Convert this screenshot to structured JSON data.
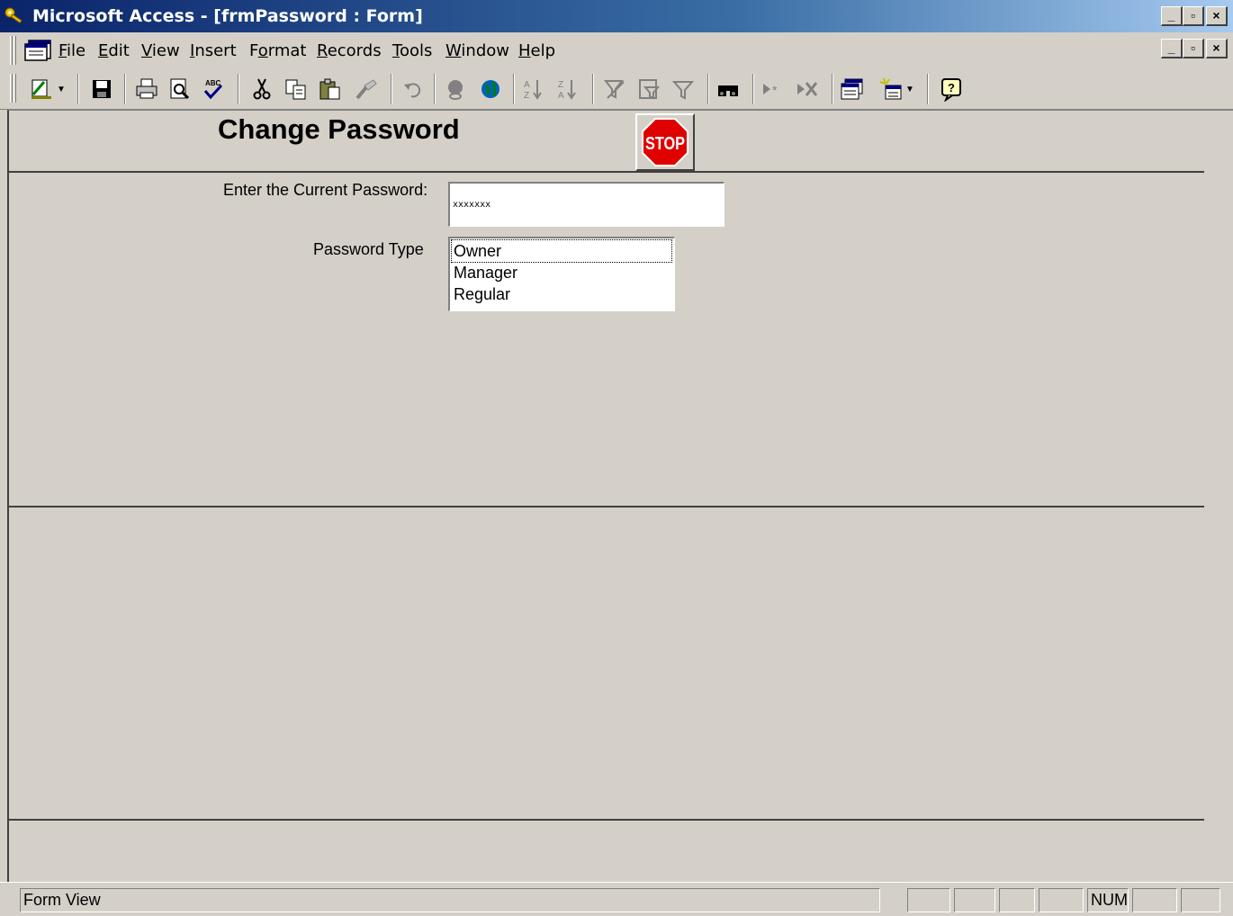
{
  "window": {
    "title": "Microsoft Access - [frmPassword : Form]",
    "controls": [
      "_",
      "□",
      "×"
    ]
  },
  "menubar": {
    "items": [
      {
        "label": "File",
        "key": "F",
        "rest": "ile"
      },
      {
        "label": "Edit",
        "key": "E",
        "rest": "dit"
      },
      {
        "label": "View",
        "key": "V",
        "rest": "iew"
      },
      {
        "label": "Insert",
        "key": "I",
        "rest": "nsert"
      },
      {
        "label": "Format",
        "pre": "F",
        "key": "o",
        "rest": "rmat"
      },
      {
        "label": "Records",
        "key": "R",
        "rest": "ecords"
      },
      {
        "label": "Tools",
        "key": "T",
        "rest": "ools"
      },
      {
        "label": "Window",
        "key": "W",
        "rest": "indow"
      },
      {
        "label": "Help",
        "key": "H",
        "rest": "elp"
      }
    ]
  },
  "toolbar": {
    "buttons": [
      "view-icon",
      "save-icon",
      "print-icon",
      "print-preview-icon",
      "spelling-icon",
      "cut-icon",
      "copy-icon",
      "paste-icon",
      "format-painter-icon",
      "undo-icon",
      "insert-hyperlink-icon",
      "web-toolbar-icon",
      "sort-ascending-icon",
      "sort-descending-icon",
      "filter-by-selection-icon",
      "filter-by-form-icon",
      "apply-filter-icon",
      "find-icon",
      "new-record-icon",
      "delete-record-icon",
      "database-window-icon",
      "new-object-icon",
      "help-icon"
    ]
  },
  "form": {
    "title": "Change Password",
    "stop_button_label": "STOP",
    "current_password_label": "Enter the Current Password:",
    "current_password_value": "xxxxxxx",
    "password_type_label": "Password Type",
    "password_type_options": [
      "Owner",
      "Manager",
      "Regular"
    ],
    "password_type_focused": "Owner"
  },
  "statusbar": {
    "mode": "Form View",
    "num": "NUM"
  },
  "colors": {
    "titlebar_start": "#0a246a",
    "titlebar_end": "#a6caf0",
    "face": "#d4d0c8",
    "stop_red": "#e00000"
  }
}
